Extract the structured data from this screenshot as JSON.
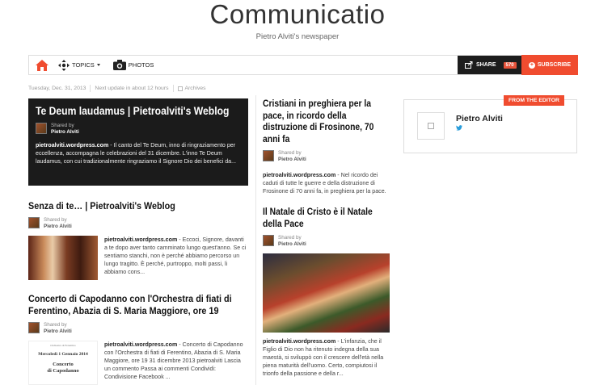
{
  "site": {
    "title": "Communicatio",
    "subtitle": "Pietro Alviti's newspaper"
  },
  "nav": {
    "topics": "TOPICS",
    "photos": "PHOTOS",
    "share_label": "SHARE",
    "share_count": "570",
    "subscribe_label": "SUBSCRIBE"
  },
  "meta": {
    "date": "Tuesday, Dec. 31, 2013",
    "next_update": "Next update in about 12 hours",
    "archives": "Archives"
  },
  "shared_by": "Shared by",
  "author": "Pietro Alviti",
  "feature": {
    "title": "Te Deum laudamus | Pietroalviti's Weblog",
    "source": "pietroalviti.wordpress.com",
    "text": " - Il canto del Te Deum, inno di ringraziamento per eccellenza, accompagna le celebrazioni del 31 dicembre. L'inno Te Deum laudamus, con cui tradizionalmente ringraziamo il Signore Dio dei benefici da..."
  },
  "stories_left": [
    {
      "title": "Senza di te… | Pietroalviti's Weblog",
      "source": "pietroalviti.wordpress.com",
      "text": " - Eccoci, Signore, davanti a te dopo aver tanto camminato lungo quest'anno.  Se ci sentiamo stanchi, non è perché abbiamo percorso un lungo tragitto. È perché, purtroppo, molti passi, li abbiamo cons..."
    },
    {
      "title": "Concerto di Capodanno con l'Orchestra di fiati di Ferentino, Abazia di S. Maria Maggiore, ore 19",
      "source": "pietroalviti.wordpress.com",
      "text": " - Concerto di Capodanno con l'Orchestra di fiati di Ferentino, Abazia di S. Maria Maggiore, ore 19 31 dicembre 2013 pietroalviti Lascia un commento Passa ai commenti Condividi: Condivisione Facebook ...",
      "image_lines": {
        "small": "Orchestra di Ferentino",
        "date": "Mercoledì 1 Gennaio 2014",
        "title1": "Concerto",
        "title2": "di Capodanno"
      }
    }
  ],
  "stories_mid": [
    {
      "title": "Cristiani in preghiera per la pace, in ricordo della distruzione di Frosinone, 70 anni fa",
      "source": "pietroalviti.wordpress.com",
      "text": " - Nel ricordo dei caduti di tutte le guerre e della distruzione di Frosinone di 70 anni fa, in preghiera per la pace."
    },
    {
      "title": "Il Natale di Cristo è il Natale della Pace",
      "source": "pietroalviti.wordpress.com",
      "text": " - L'infanzia, che il Figlio di Dio non ha ritenuto indegna della sua maestà, si sviluppò con il crescere dell'età nella piena maturità dell'uomo. Certo, compiutosi il trionfo della passione e della r..."
    }
  ],
  "editor": {
    "tag": "FROM THE EDITOR",
    "name": "Pietro Alviti"
  },
  "colors": {
    "accent": "#f04c2f",
    "dark": "#1b1b1b",
    "twitter": "#2a9ddb"
  }
}
